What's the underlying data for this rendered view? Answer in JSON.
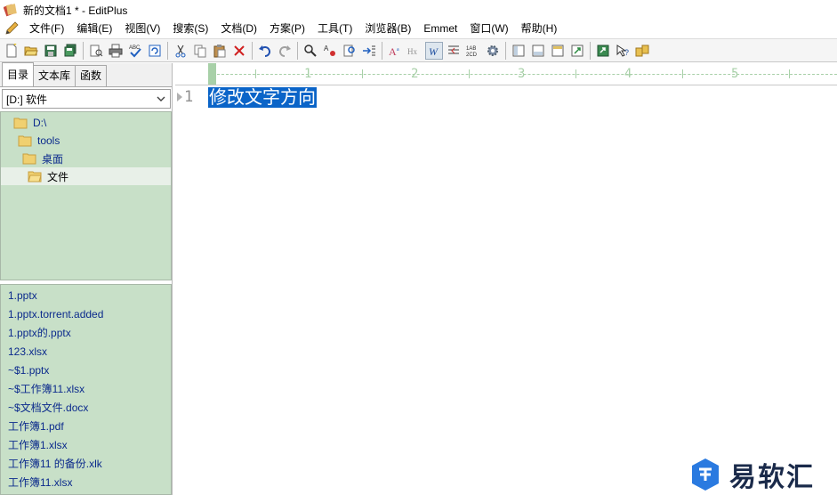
{
  "window": {
    "title": "新的文档1 * - EditPlus"
  },
  "menu": {
    "items": [
      "文件(F)",
      "编辑(E)",
      "视图(V)",
      "搜索(S)",
      "文档(D)",
      "方案(P)",
      "工具(T)",
      "浏览器(B)",
      "Emmet",
      "窗口(W)",
      "帮助(H)"
    ]
  },
  "toolbar": {
    "icons": [
      "new-file-icon",
      "open-folder-icon",
      "save-icon",
      "save-all-icon",
      "print-preview-icon",
      "print-icon",
      "spell-check-icon",
      "refresh-icon",
      "cut-icon",
      "copy-icon",
      "paste-icon",
      "delete-icon",
      "undo-icon",
      "redo-icon",
      "find-icon",
      "replace-icon",
      "find-in-files-icon",
      "goto-line-icon",
      "font-icon",
      "hex-icon",
      "word-wrap-icon",
      "line-number-icon",
      "ruler-icon",
      "settings-icon",
      "sidebar-icon",
      "output-icon",
      "cliptext-icon",
      "browser-icon",
      "run-icon",
      "help-icon",
      "swap-icon"
    ]
  },
  "sidebar": {
    "tabs": [
      "目录",
      "文本库",
      "函数"
    ],
    "active_tab": "目录",
    "drive": "[D:] 软件",
    "tree": [
      {
        "label": "D:\\",
        "level": 0
      },
      {
        "label": "tools",
        "level": 1
      },
      {
        "label": "桌面",
        "level": 2
      },
      {
        "label": "文件",
        "level": 3,
        "selected": true
      }
    ],
    "files": [
      "1.pptx",
      "1.pptx.torrent.added",
      "1.pptx的.pptx",
      "123.xlsx",
      "~$1.pptx",
      "~$工作簿11.xlsx",
      "~$文档文件.docx",
      "工作簿1.pdf",
      "工作簿1.xlsx",
      "工作簿11 的备份.xlk",
      "工作簿11.xlsx"
    ]
  },
  "editor": {
    "ruler_numbers": [
      "1",
      "2",
      "3",
      "4",
      "5"
    ],
    "line_number": "1",
    "line_text": "修改文字方向"
  },
  "watermark": {
    "text": "易软汇"
  },
  "colors": {
    "panel_green": "#c8e0c8",
    "link_blue": "#0b2a8c",
    "selection_blue": "#0a64c8",
    "ruler_green": "#a8d0a8"
  }
}
